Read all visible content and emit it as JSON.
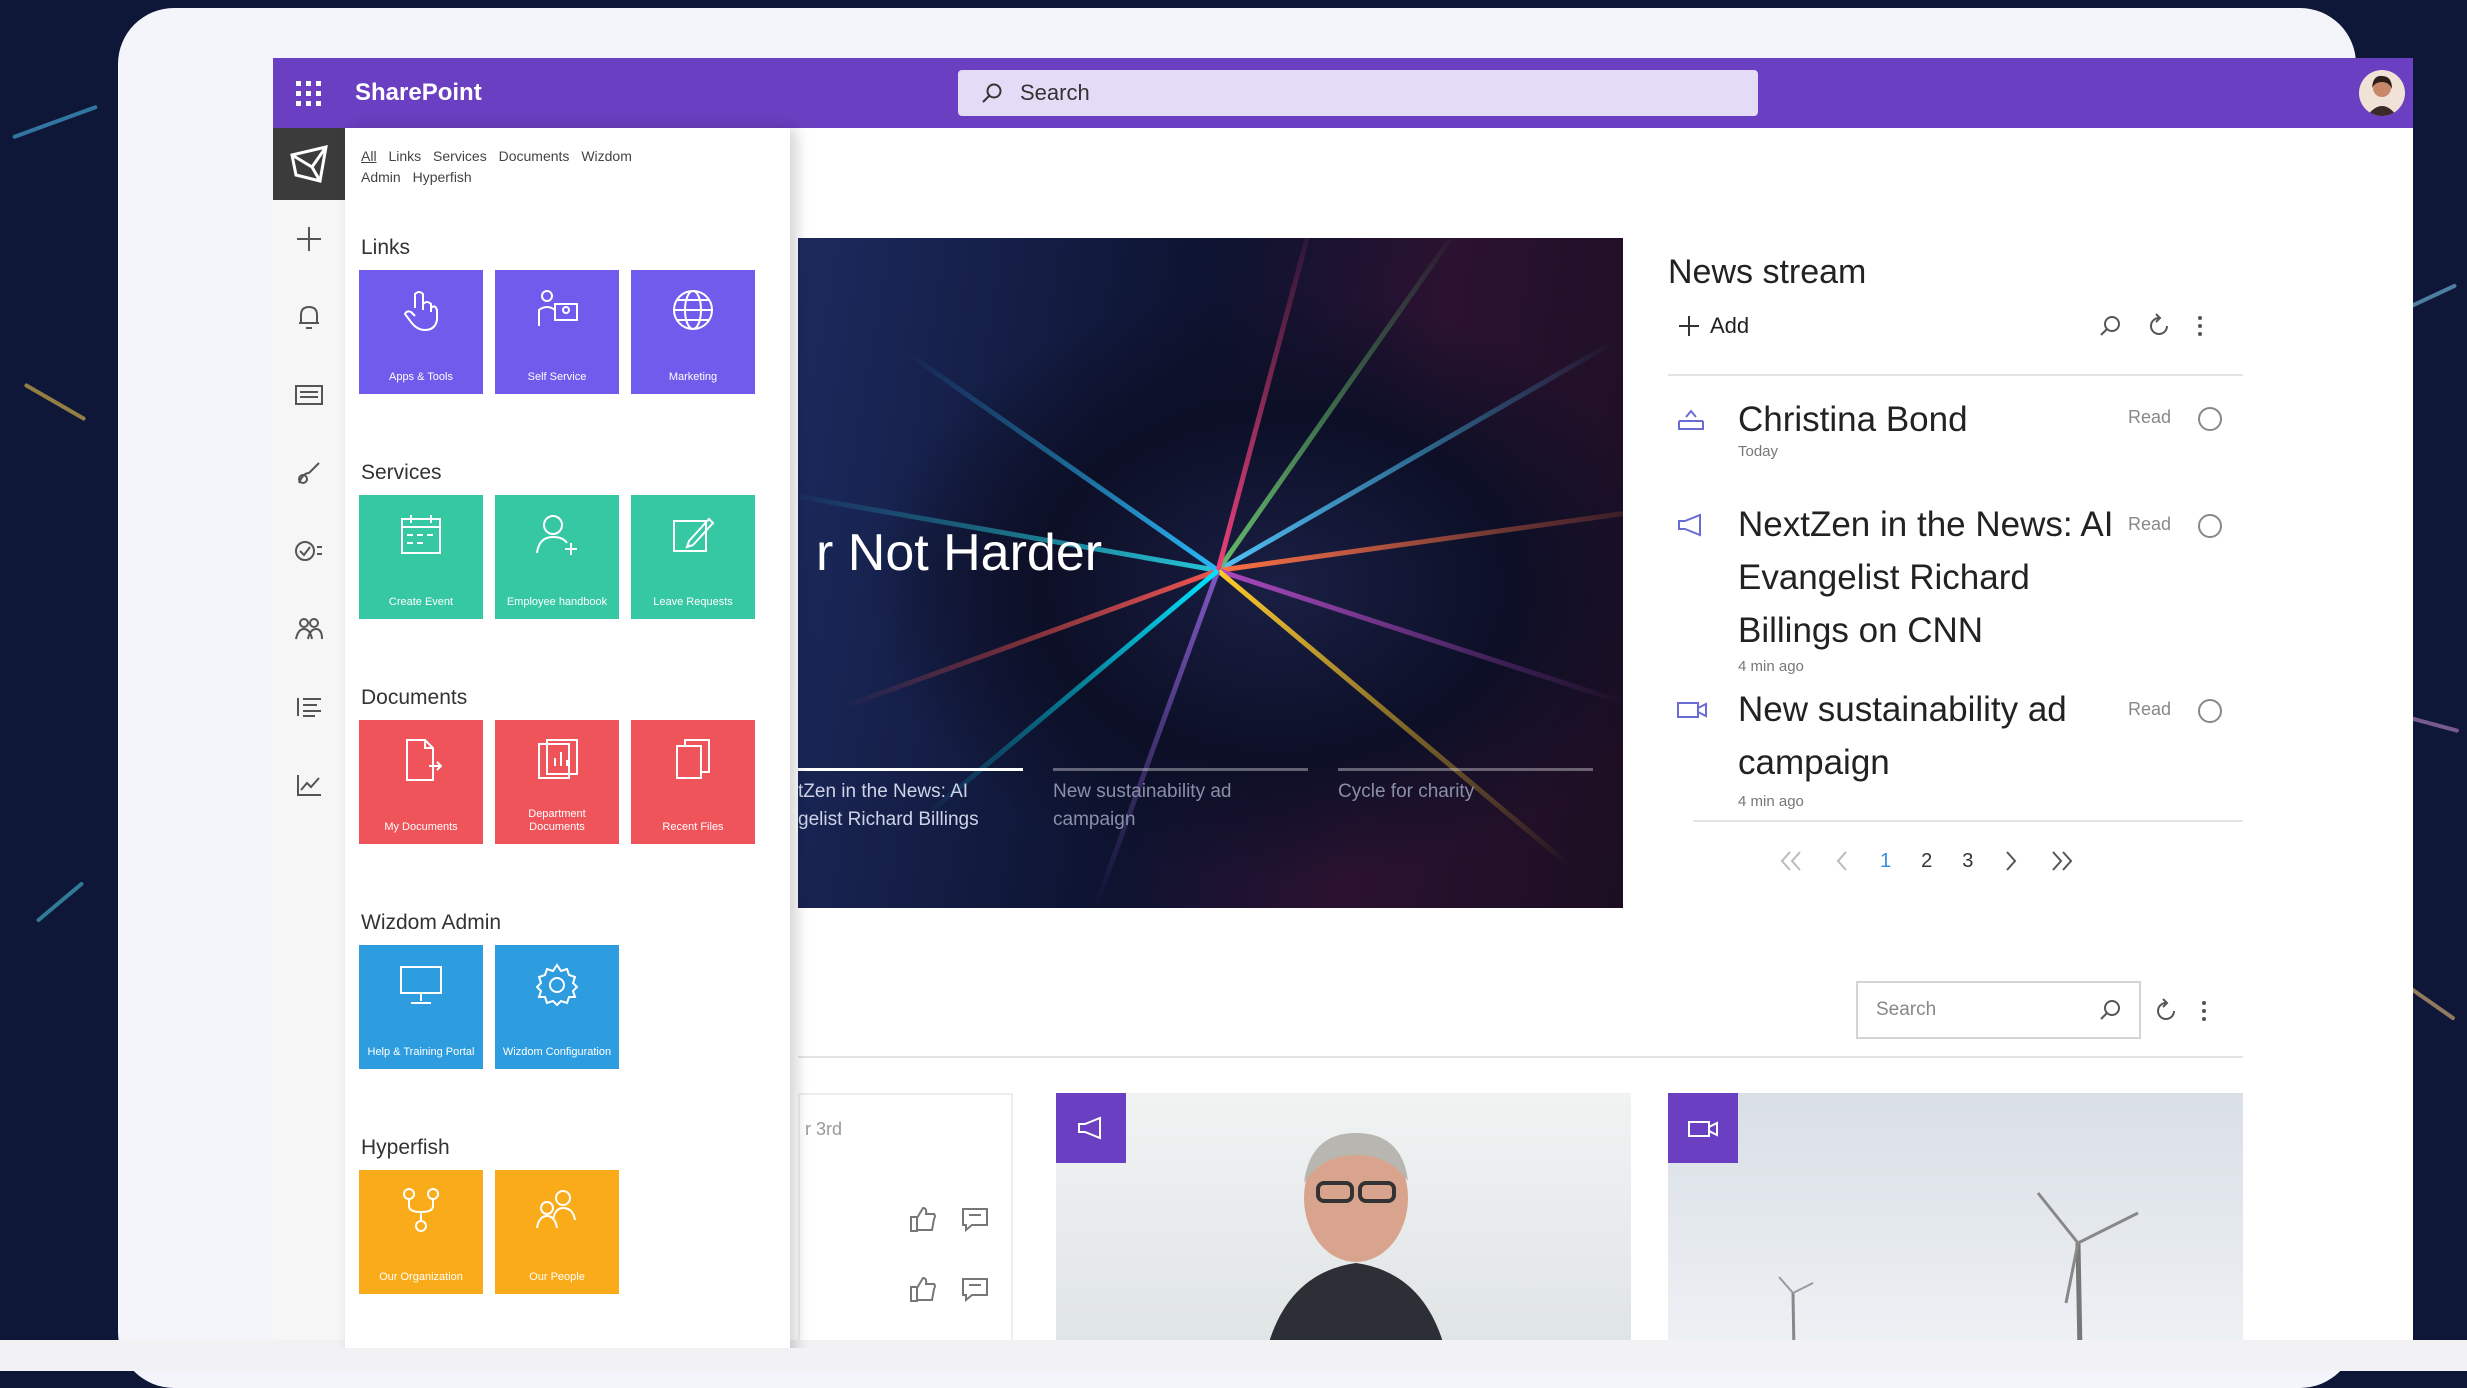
{
  "suitebar": {
    "app_title": "SharePoint",
    "search_placeholder": "Search",
    "colors": {
      "bar": "#6b3fc1",
      "search": "#e4dcf7"
    }
  },
  "left_rail": {
    "icons": [
      "brand-logo-icon",
      "plus-icon",
      "bell-icon",
      "news-icon",
      "paint-icon",
      "tasks-icon",
      "people-icon",
      "list-icon",
      "chart-icon"
    ]
  },
  "panel": {
    "tabs": [
      "All",
      "Links",
      "Services",
      "Documents",
      "Wizdom",
      "Admin",
      "Hyperfish"
    ],
    "sections": [
      {
        "title": "Links",
        "color": "#6f5ced",
        "tiles": [
          {
            "label": "Apps & Tools",
            "icon": "touch-icon"
          },
          {
            "label": "Self Service",
            "icon": "people-board-icon"
          },
          {
            "label": "Marketing",
            "icon": "globe-icon"
          }
        ]
      },
      {
        "title": "Services",
        "color": "#36c8a3",
        "tiles": [
          {
            "label": "Create Event",
            "icon": "calendar-icon"
          },
          {
            "label": "Employee handbook",
            "icon": "add-person-icon"
          },
          {
            "label": "Leave Requests",
            "icon": "edit-icon"
          }
        ]
      },
      {
        "title": "Documents",
        "color": "#f0545b",
        "tiles": [
          {
            "label": "My Documents",
            "icon": "doc-export-icon"
          },
          {
            "label": "Department Documents",
            "icon": "doc-chart-icon"
          },
          {
            "label": "Recent Files",
            "icon": "copy-icon"
          }
        ]
      },
      {
        "title": "Wizdom Admin",
        "color": "#2d9de0",
        "tiles": [
          {
            "label": "Help & Training Portal",
            "icon": "monitor-icon"
          },
          {
            "label": "Wizdom Configuration",
            "icon": "gear-icon"
          }
        ]
      },
      {
        "title": "Hyperfish",
        "color": "#f9ab1a",
        "tiles": [
          {
            "label": "Our Organization",
            "icon": "org-icon"
          },
          {
            "label": "Our People",
            "icon": "people-icon"
          }
        ]
      }
    ]
  },
  "hero": {
    "title": "r Not Harder",
    "captions": [
      "tZen in the News: AI\ngelist Richard Billings",
      "New sustainability ad\ncampaign",
      "Cycle for charity"
    ]
  },
  "news": {
    "title": "News stream",
    "add_label": "Add",
    "items": [
      {
        "title": "Christina Bond",
        "time": "Today",
        "read": "Read",
        "icon": "inbox-icon"
      },
      {
        "title": "NextZen in the News: AI Evangelist Richard Billings  on CNN",
        "time": "4 min ago",
        "read": "Read",
        "icon": "megaphone-icon"
      },
      {
        "title": "New sustainability ad campaign",
        "time": "4 min ago",
        "read": "Read",
        "icon": "video-icon"
      }
    ],
    "pages": [
      "1",
      "2",
      "3"
    ]
  },
  "feed": {
    "search_placeholder": "Search",
    "partial_date": "r 3rd"
  }
}
